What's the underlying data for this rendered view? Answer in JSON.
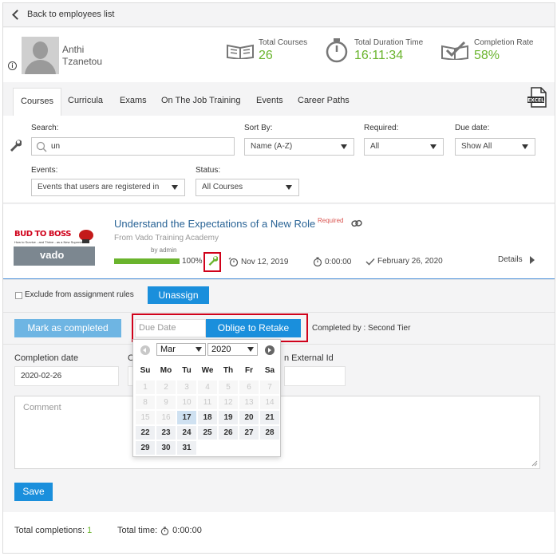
{
  "nav": {
    "back_label": "Back to employees list"
  },
  "user": {
    "first_name": "Anthi",
    "last_name": "Tzanetou"
  },
  "stats": {
    "total_courses_label": "Total Courses",
    "total_courses": "26",
    "total_duration_label": "Total Duration Time",
    "total_duration": "16:11:34",
    "completion_rate_label": "Completion Rate",
    "completion_rate": "58%"
  },
  "tabs": [
    {
      "label": "Courses",
      "active": true
    },
    {
      "label": "Curricula"
    },
    {
      "label": "Exams"
    },
    {
      "label": "On The Job Training"
    },
    {
      "label": "Events"
    },
    {
      "label": "Career Paths"
    }
  ],
  "export_icon_text": "EXCEL",
  "filters": {
    "search_label": "Search:",
    "search_value": "un",
    "sort_label": "Sort By:",
    "sort_value": "Name (A-Z)",
    "required_label": "Required:",
    "required_value": "All",
    "due_label": "Due date:",
    "due_value": "Show All",
    "events_label": "Events:",
    "events_value": "Events that users are registered in",
    "status_label": "Status:",
    "status_value": "All Courses"
  },
  "course": {
    "logo_title": "BUD TO BOSS",
    "logo_subtitle": "How to Survive - and Thrive - as a New Supervisor",
    "logo_brand": "vado",
    "title": "Understand the Expectations of a New Role",
    "required_tag": "Required",
    "from": "From Vado Training Academy",
    "by": "by admin",
    "progress": 100,
    "progress_label": "100%",
    "due_date": "Nov 12, 2019",
    "duration": "0:00:00",
    "completed_date": "February 26, 2020",
    "details_label": "Details"
  },
  "assign": {
    "exclude_label": "Exclude from assignment rules",
    "unassign_label": "Unassign"
  },
  "actions": {
    "mark_completed_label": "Mark as completed",
    "due_date_placeholder": "Due Date",
    "oblige_label": "Oblige to Retake",
    "completed_by": "Completed by : Second Tier"
  },
  "form": {
    "completion_date_label": "Completion date",
    "completion_date_value": "2020-02-26",
    "hidden_label_initial": "C",
    "external_id_label": "n External Id",
    "comment_placeholder": "Comment",
    "save_label": "Save"
  },
  "calendar": {
    "month": "Mar",
    "year": "2020",
    "weekdays": [
      "Su",
      "Mo",
      "Tu",
      "We",
      "Th",
      "Fr",
      "Sa"
    ],
    "weeks": [
      [
        "1",
        "2",
        "3",
        "4",
        "5",
        "6",
        "7"
      ],
      [
        "8",
        "9",
        "10",
        "11",
        "12",
        "13",
        "14"
      ],
      [
        "15",
        "16",
        "17",
        "18",
        "19",
        "20",
        "21"
      ],
      [
        "22",
        "23",
        "24",
        "25",
        "26",
        "27",
        "28"
      ],
      [
        "29",
        "30",
        "31",
        "",
        "",
        "",
        ""
      ]
    ],
    "first_enabled_day": 17,
    "today": 17
  },
  "footer": {
    "total_completions_label": "Total completions:",
    "total_completions": "1",
    "total_time_label": "Total time:",
    "total_time": "0:00:00"
  },
  "colors": {
    "accent": "#1a8fdc",
    "success": "#6ab42d",
    "highlight": "#d0021b",
    "link": "#2a6496"
  }
}
